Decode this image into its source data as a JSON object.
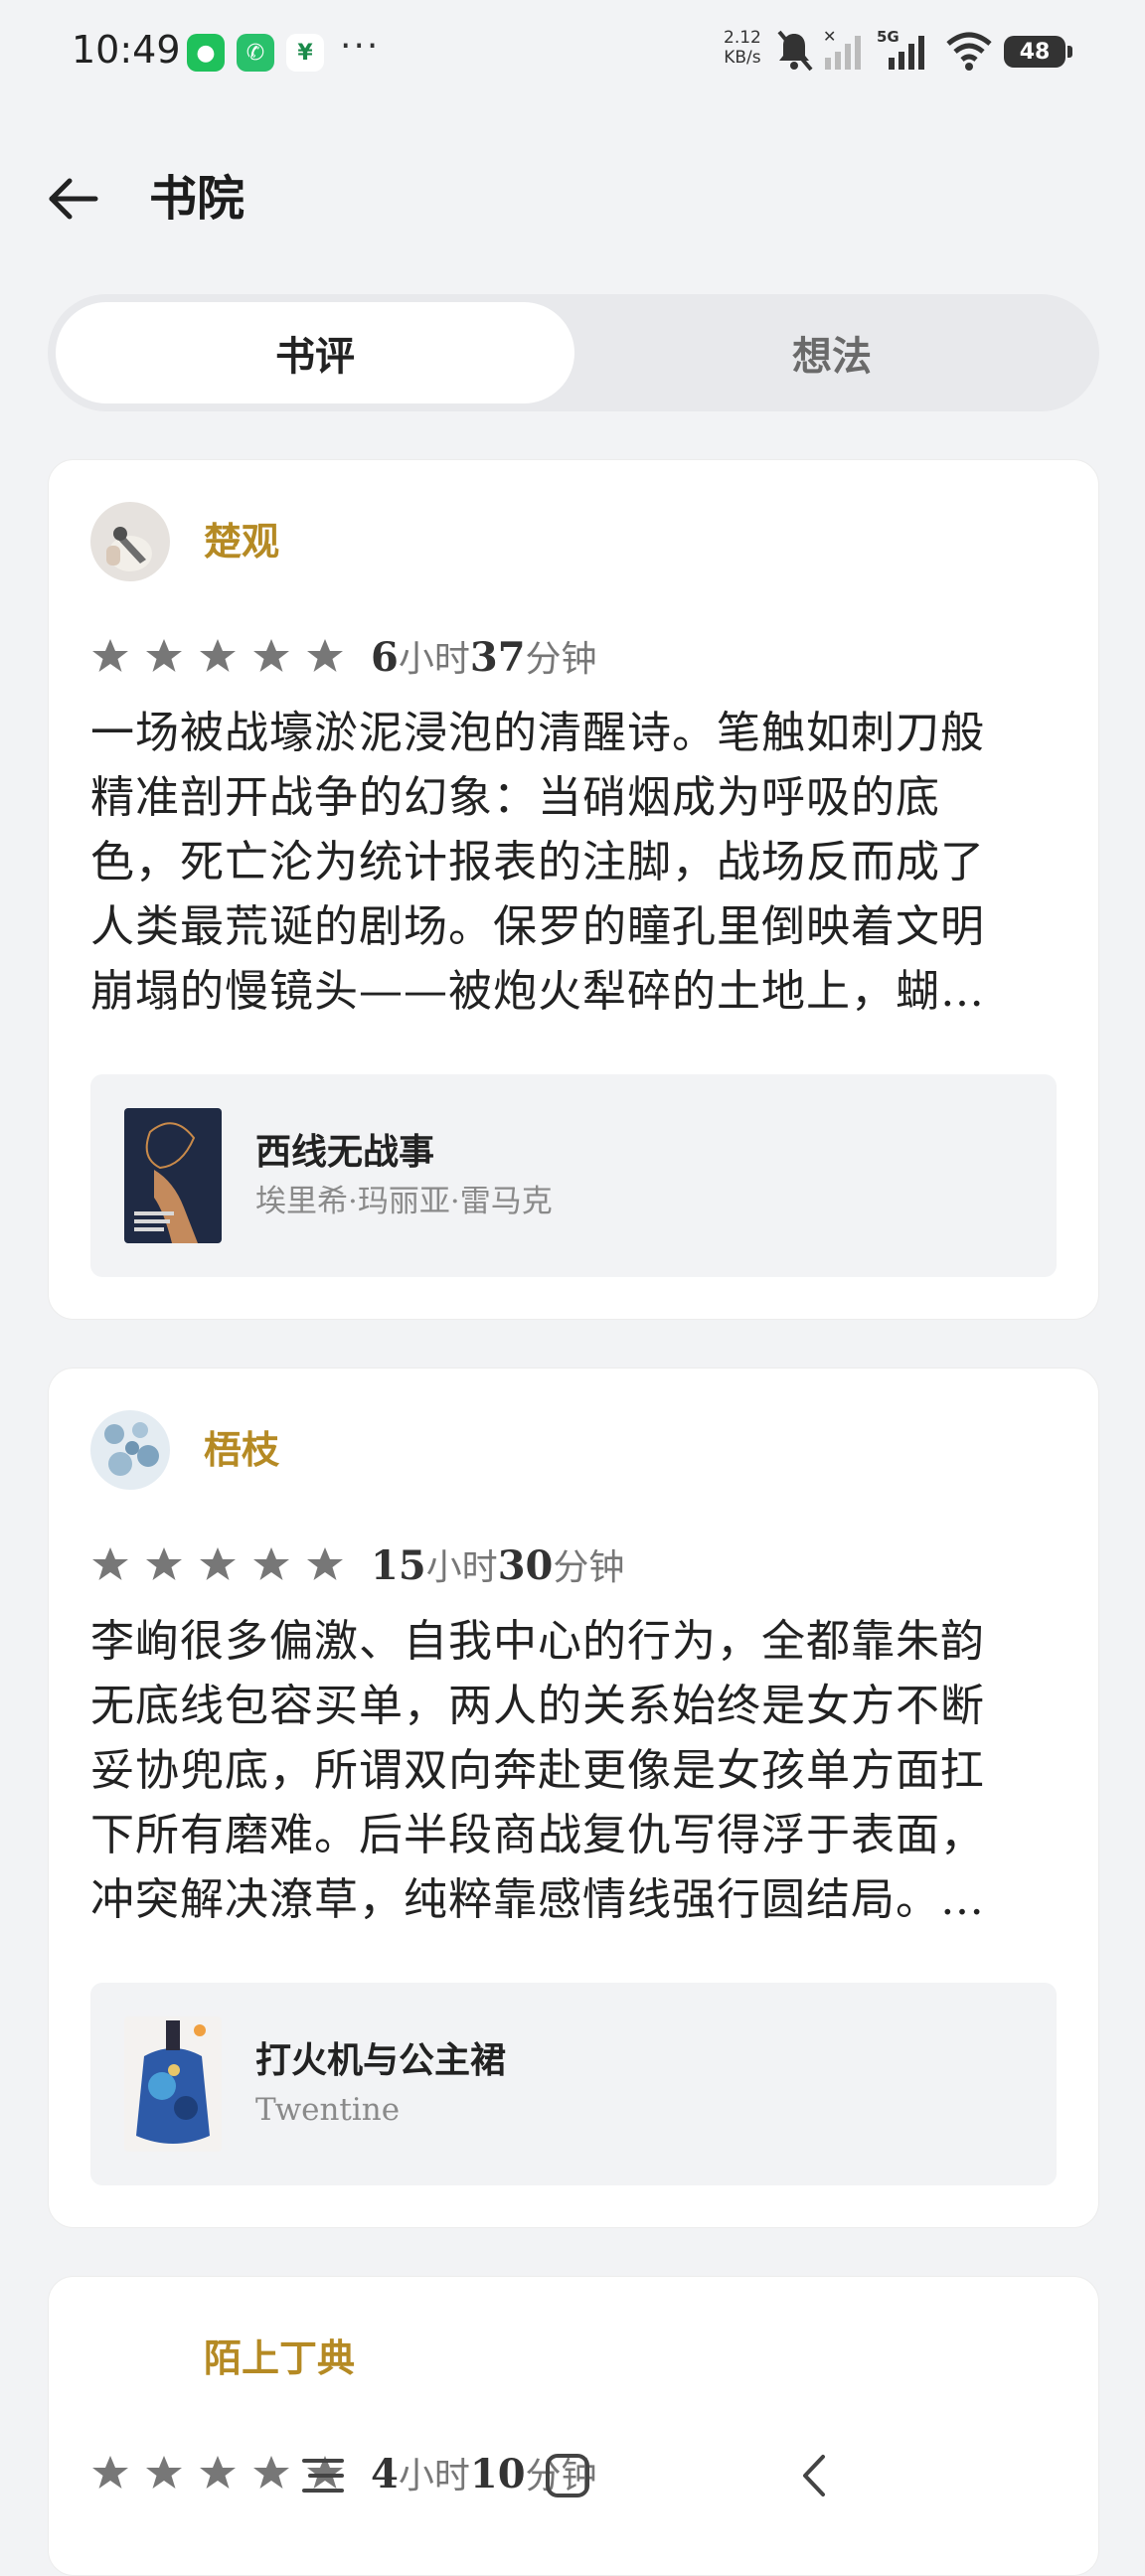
{
  "status_bar": {
    "time": "10:49",
    "more": "···",
    "speed_value": "2.12",
    "speed_unit": "KB/s",
    "network_type": "5G",
    "battery": "48"
  },
  "header": {
    "title": "书院"
  },
  "tabs": {
    "active": "书评",
    "inactive": "想法"
  },
  "reviews": [
    {
      "user": "楚观",
      "hours": "6",
      "hours_unit": "小时",
      "minutes": "37",
      "minutes_unit": "分钟",
      "lines": [
        "一场被战壕淤泥浸泡的清醒诗。笔触如刺刀般",
        "精准剖开战争的幻象：当硝烟成为呼吸的底",
        "色，死亡沦为统计报表的注脚，战场反而成了",
        "人类最荒诞的剧场。保罗的瞳孔里倒映着文明",
        "崩塌的慢镜头——被炮火犁碎的土地上，蝴…"
      ],
      "book_title": "西线无战事",
      "book_author": "埃里希·玛丽亚·雷马克"
    },
    {
      "user": "梧枝",
      "hours": "15",
      "hours_unit": "小时",
      "minutes": "30",
      "minutes_unit": "分钟",
      "lines": [
        "李峋很多偏激、自我中心的行为，全都靠朱韵",
        "无底线包容买单，两人的关系始终是女方不断",
        "妥协兜底，所谓双向奔赴更像是女孩单方面扛",
        "下所有磨难。后半段商战复仇写得浮于表面，",
        "冲突解决潦草，纯粹靠感情线强行圆结局。…"
      ],
      "book_title": "打火机与公主裙",
      "book_author": "Twentine"
    },
    {
      "user": "陌上丁典",
      "hours": "4",
      "hours_unit": "小时",
      "minutes": "10",
      "minutes_unit": "分钟"
    }
  ]
}
